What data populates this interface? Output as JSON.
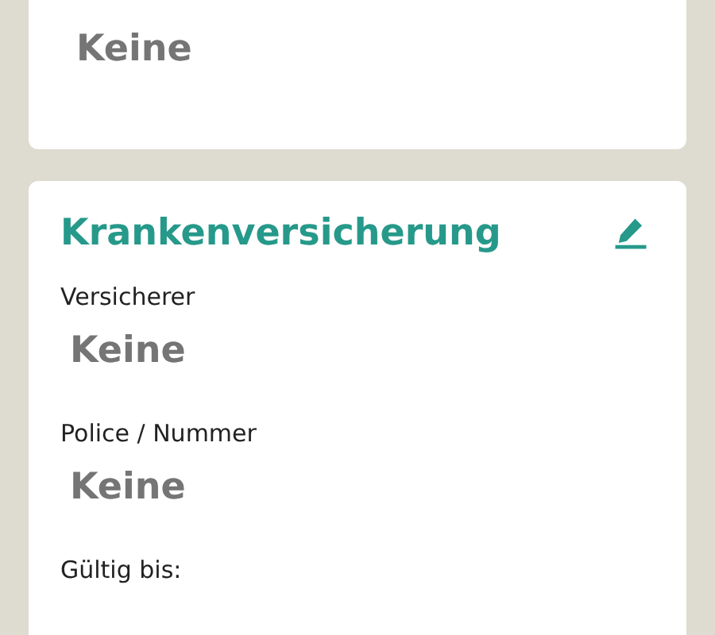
{
  "top_card": {
    "value": "Keine"
  },
  "insurance_card": {
    "title": "Krankenversicherung",
    "fields": [
      {
        "label": "Versicherer",
        "value": "Keine"
      },
      {
        "label": "Police / Nummer",
        "value": "Keine"
      },
      {
        "label": "Gültig bis:"
      }
    ]
  }
}
